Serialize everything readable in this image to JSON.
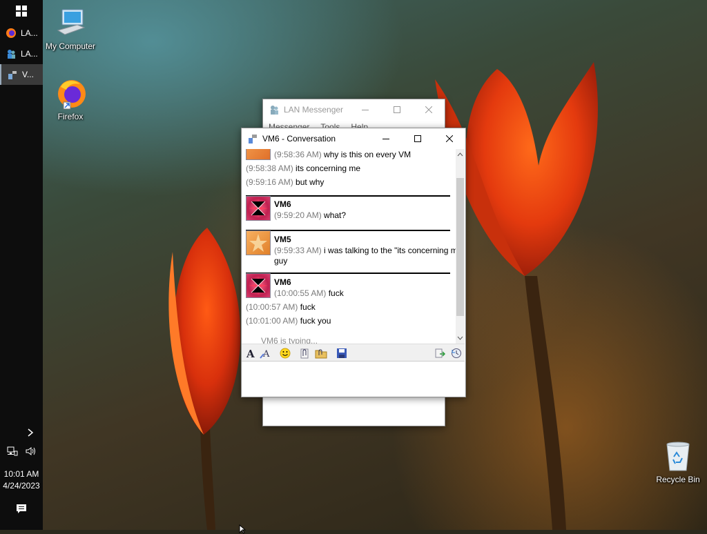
{
  "taskbar": {
    "items": [
      {
        "label": "LA...",
        "icon": "firefox-icon"
      },
      {
        "label": "LA...",
        "icon": "lan-messenger-icon"
      },
      {
        "label": "V...",
        "icon": "conversation-icon"
      }
    ],
    "clock": {
      "time": "10:01 AM",
      "date": "4/24/2023"
    }
  },
  "desktop": {
    "icons": [
      {
        "label": "My Computer",
        "icon": "computer-icon"
      },
      {
        "label": "Firefox",
        "icon": "firefox-icon"
      },
      {
        "label": "Recycle Bin",
        "icon": "recycle-bin-icon"
      }
    ]
  },
  "messenger_window": {
    "title": "LAN Messenger",
    "menu": [
      "Messenger",
      "Tools",
      "Help"
    ]
  },
  "conversation_window": {
    "title": "VM6 - Conversation",
    "messages": [
      {
        "time": "(9:58:36 AM)",
        "text": "why is this on every VM"
      },
      {
        "time": "(9:58:38 AM)",
        "text": "its concerning me"
      },
      {
        "time": "(9:59:16 AM)",
        "text": "but why"
      },
      {
        "sender": "VM6",
        "time": "(9:59:20 AM)",
        "text": "what?"
      },
      {
        "sender": "VM5",
        "time": "(9:59:33 AM)",
        "text": "i was talking to the \"its concerning me\"",
        "text2": "guy"
      },
      {
        "sender": "VM6",
        "time": "(10:00:55 AM)",
        "text": "fuck"
      },
      {
        "time": "(10:00:57 AM)",
        "text": "fuck"
      },
      {
        "time": "(10:01:00 AM)",
        "text": "fuck you"
      }
    ],
    "typing_status": "VM6 is typing...",
    "colors": {
      "timestamp": "#7a7a7a",
      "separator": "#000000"
    }
  }
}
